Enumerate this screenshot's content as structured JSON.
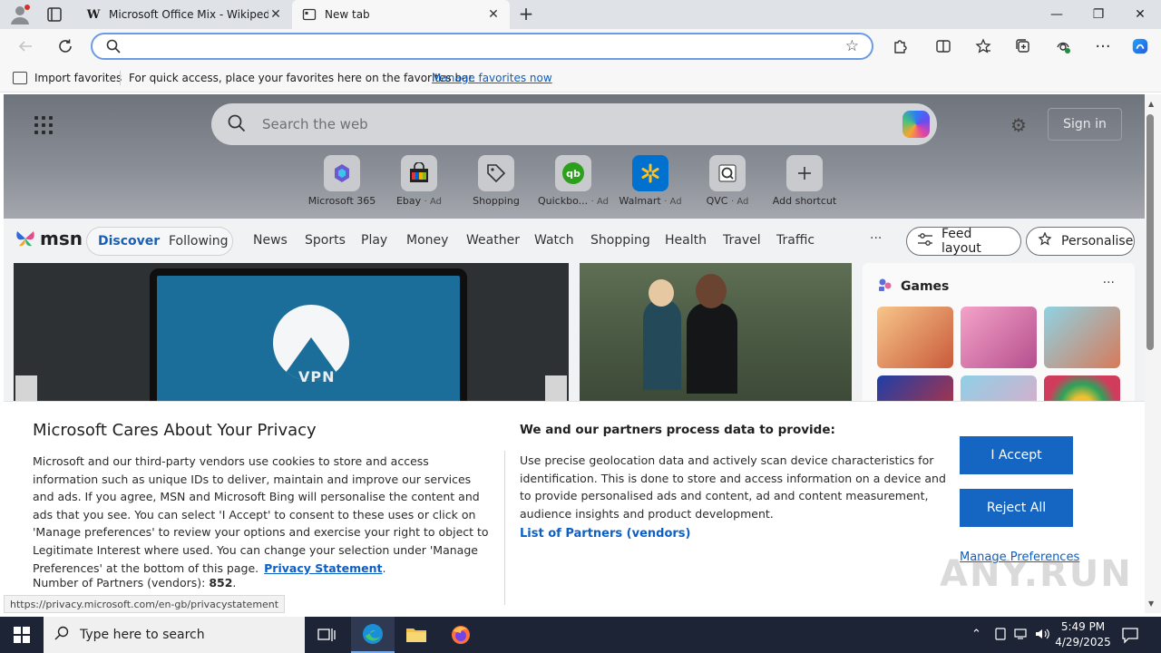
{
  "browser": {
    "tabs": [
      {
        "title": "Microsoft Office Mix - Wikipedia",
        "favicon": "W",
        "active": false
      },
      {
        "title": "New tab",
        "active": true
      }
    ],
    "window_controls": {
      "minimize": "—",
      "restore": "❐",
      "close": "✕"
    },
    "address_bar": {
      "value": "",
      "placeholder": ""
    },
    "favorites_bar": {
      "import_label": "Import favorites",
      "message": "For quick access, place your favorites here on the favorites bar.",
      "manage_link": "Manage favorites now"
    }
  },
  "newtab": {
    "search_placeholder": "Search the web",
    "sign_in": "Sign in",
    "shortcuts": [
      {
        "label": "Microsoft 365",
        "ad": ""
      },
      {
        "label": "Ebay",
        "ad": "· Ad"
      },
      {
        "label": "Shopping",
        "ad": ""
      },
      {
        "label": "Quickbo...",
        "ad": "· Ad"
      },
      {
        "label": "Walmart",
        "ad": "· Ad"
      },
      {
        "label": "QVC",
        "ad": "· Ad"
      },
      {
        "label": "Add shortcut",
        "ad": ""
      }
    ],
    "msn": {
      "logo": "msn",
      "discover": "Discover",
      "following": "Following",
      "nav": [
        "News",
        "Sports",
        "Play",
        "Money",
        "Weather",
        "Watch",
        "Shopping",
        "Health",
        "Travel",
        "Traffic"
      ],
      "more": "···",
      "feed_layout": "Feed layout",
      "personalise": "Personalise"
    },
    "card1_text": "VPN",
    "games": {
      "title": "Games",
      "more": "···"
    }
  },
  "privacy": {
    "title": "Microsoft Cares About Your Privacy",
    "body": "Microsoft and our third-party vendors use cookies to store and access information such as unique IDs to deliver, maintain and improve our services and ads. If you agree, MSN and Microsoft Bing will personalise the content and ads that you see. You can select 'I Accept' to consent to these uses or click on 'Manage preferences' to review your options and exercise your right to object to Legitimate Interest where used.  You can change your selection under 'Manage Preferences' at the bottom of this page.",
    "privacy_link": "Privacy Statement",
    "partners_label": "Number of Partners (vendors):",
    "partners_count": "852",
    "right_title": "We and our partners process data to provide:",
    "right_body": "Use precise geolocation data and actively scan device characteristics for identification. This is done to store and access information on a device and to provide personalised ads and content, ad and content measurement, audience insights and product development.",
    "vendors_link": "List of Partners (vendors)",
    "accept": "I Accept",
    "reject": "Reject All",
    "manage": "Manage Preferences"
  },
  "status_url": "https://privacy.microsoft.com/en-gb/privacystatement",
  "watermark": "ANY.RUN",
  "taskbar": {
    "search_placeholder": "Type here to search",
    "time": "5:49 PM",
    "date": "4/29/2025"
  },
  "colors": {
    "accent": "#1466c2",
    "link": "#0b5fc5",
    "taskbar": "#1c2436"
  }
}
